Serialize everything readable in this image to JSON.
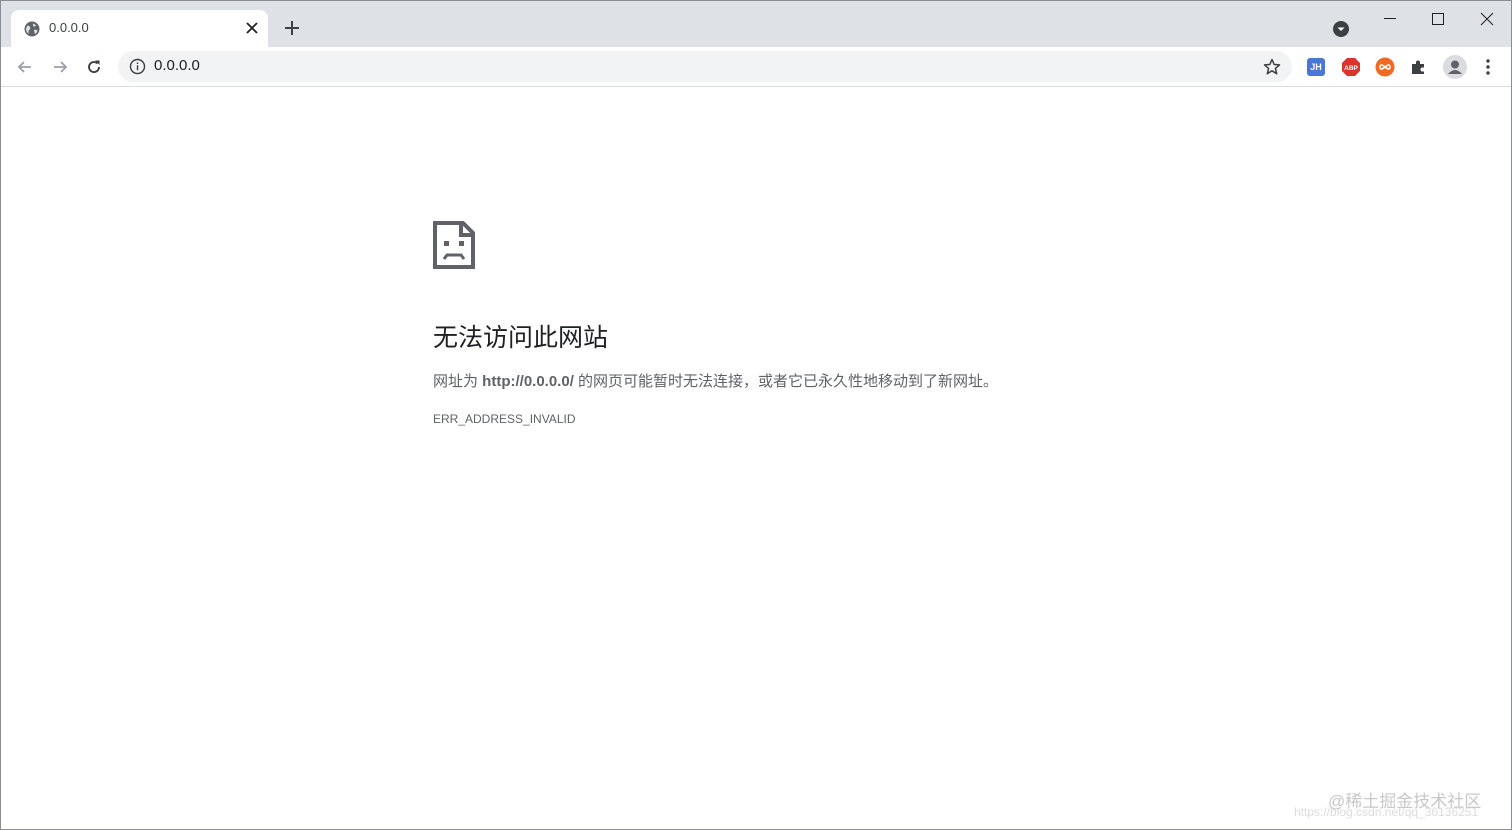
{
  "tab": {
    "title": "0.0.0.0",
    "favicon": "globe-icon"
  },
  "omnibox": {
    "url": "0.0.0.0"
  },
  "extensions": {
    "jh_label": "JH",
    "abp_label": "ABP"
  },
  "error": {
    "title": "无法访问此网站",
    "desc_before": "网址为 ",
    "desc_url": "http://0.0.0.0/",
    "desc_after": " 的网页可能暂时无法连接，或者它已永久性地移动到了新网址。",
    "code": "ERR_ADDRESS_INVALID"
  },
  "watermark": {
    "main": "@稀土掘金技术社区",
    "sub": "https://blog.csdn.net/qq_36136251"
  },
  "colors": {
    "tabstrip": "#dee1e6",
    "omnibox_bg": "#f1f3f4",
    "abp_red": "#d9352b",
    "infinity_orange": "#f06b22",
    "jh_blue": "#4a76d4"
  }
}
